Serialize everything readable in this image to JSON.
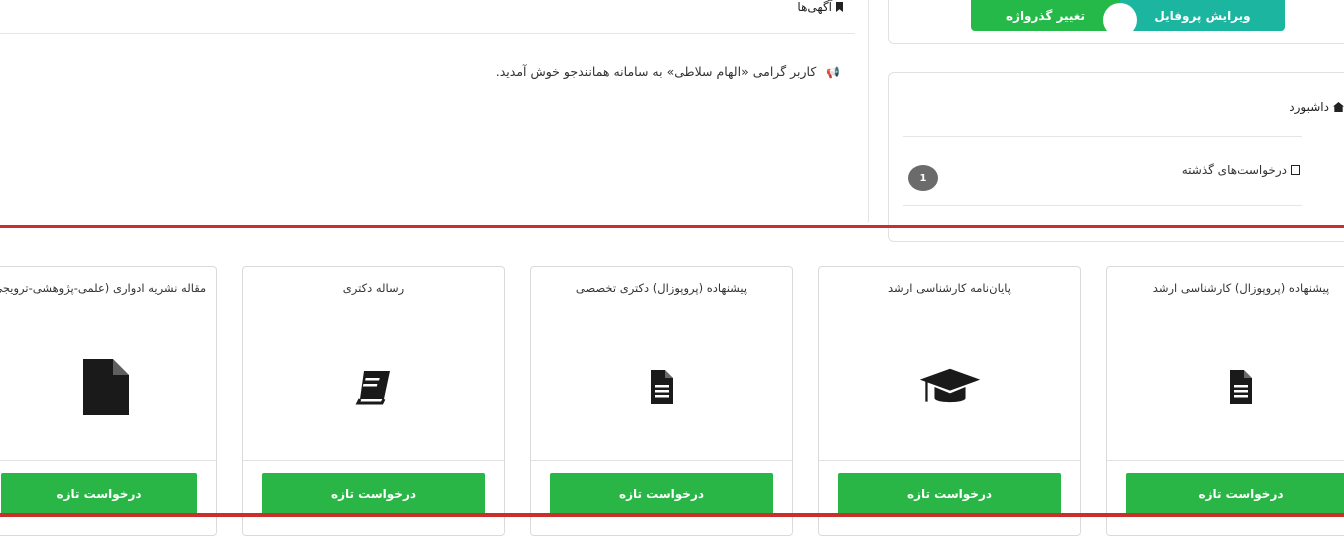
{
  "announcements": {
    "title": "آگهی‌ها",
    "message": "کاربر گرامی «الهام سلاطی» به سامانه همانندجو خوش آمدید."
  },
  "profile": {
    "edit_profile_label": "ویرایش پروفایل",
    "change_password_label": "تغییر گذرواژه"
  },
  "dashboard": {
    "title": "داشبورد",
    "previous_requests_label": "درخواست‌های گذشته",
    "previous_requests_count": "1"
  },
  "cards": [
    {
      "title": "پیشنهاده (پروپوزال) کارشناسی ارشد",
      "icon": "file-text-icon",
      "button": "درخواست تازه"
    },
    {
      "title": "پایان‌نامه کارشناسی ارشد",
      "icon": "graduation-cap-icon",
      "button": "درخواست تازه"
    },
    {
      "title": "پیشنهاده (پروپوزال) دکتری تخصصی",
      "icon": "file-text-icon",
      "button": "درخواست تازه"
    },
    {
      "title": "رساله دکتری",
      "icon": "book-icon",
      "button": "درخواست تازه"
    },
    {
      "title": "مقاله نشریه ادواری (علمی-پژوهشی-ترویجی)",
      "icon": "file-icon",
      "button": "درخواست تازه"
    }
  ],
  "colors": {
    "green": "#29b647",
    "teal": "#1cb5a0",
    "highlight_red": "#c9302c"
  }
}
